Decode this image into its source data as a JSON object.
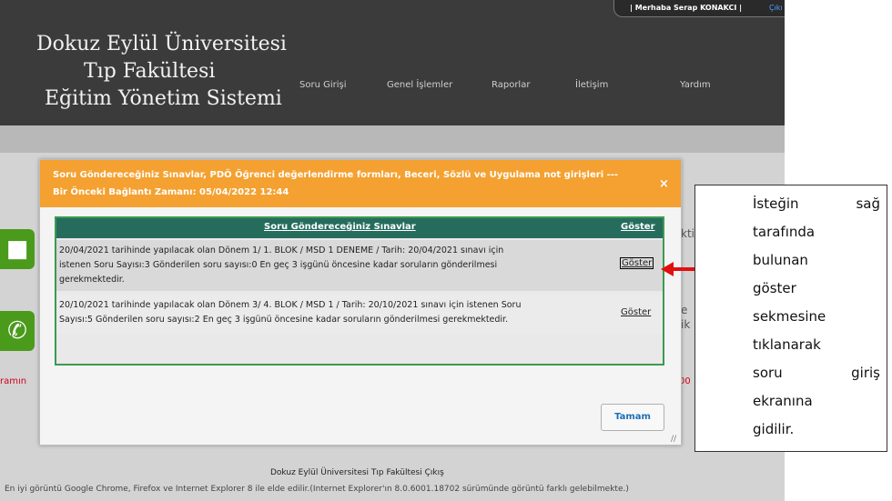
{
  "header": {
    "greeting": "| Merhaba Serap KONAKCI |",
    "logout": "Çıkı",
    "title_lines": [
      "Dokuz Eylül Üniversitesi",
      "Tıp Fakültesi",
      "Eğitim Yönetim Sistemi"
    ],
    "nav": [
      "Soru Girişi",
      "Genel İşlemler",
      "Raporlar",
      "İletişim",
      "Yardım"
    ]
  },
  "background": {
    "red_text": "ramın",
    "red_right": "00",
    "partial_right_1": "kti",
    "partial_right_2a": "e",
    "partial_right_2b": "ik"
  },
  "modal": {
    "header_line1": "Soru Göndereceğiniz Sınavlar, PDÖ Öğrenci değerlendirme formları, Beceri, Sözlü ve Uygulama not girişleri ---",
    "header_line2": "Bir Önceki Bağlantı Zamanı: 05/04/2022 12:44",
    "close": "×",
    "table_title": "Soru Göndereceğiniz Sınavlar",
    "table_show": "Göster",
    "rows": [
      {
        "lines": [
          "20/04/2021 tarihinde yapılacak olan Dönem 1/ 1. BLOK / MSD 1 DENEME / Tarih: 20/04/2021 sınavı için",
          "istenen Soru Sayısı:3 Gönderilen soru sayısı:0 En geç 3 işgünü öncesine kadar soruların gönderilmesi",
          "gerekmektedir."
        ],
        "action": "Göster"
      },
      {
        "lines": [
          "20/10/2021 tarihinde yapılacak olan Dönem 3/ 4. BLOK / MSD 1 / Tarih: 20/10/2021 sınavı için istenen Soru",
          "Sayısı:5 Gönderilen soru sayısı:2 En geç 3 işgünü öncesine kadar soruların gönderilmesi gerekmektedir."
        ],
        "action": "Göster"
      }
    ],
    "ok_button": "Tamam"
  },
  "callout": {
    "lines": [
      [
        "İsteğin",
        "sağ"
      ],
      [
        "tarafında"
      ],
      [
        "bulunan"
      ],
      [
        "göster"
      ],
      [
        "sekmesine"
      ],
      [
        "tıklanarak"
      ],
      [
        "soru",
        "giriş"
      ],
      [
        "ekranına"
      ],
      [
        "gidilir."
      ]
    ]
  },
  "footer": {
    "title": "Dokuz Eylül Üniversitesi Tıp Fakültesi Çıkış",
    "note": "En iyi görüntü Google Chrome, Firefox  ve  Internet Explorer 8 ile elde edilir.(Internet Explorer'ın 8.0.6001.18702 sürümünde görüntü farklı gelebilmekte.)"
  },
  "colors": {
    "header_bg": "#3b3b3b",
    "modal_header": "#f4a131",
    "table_header": "#256c5d",
    "arrow": "#e01010",
    "ok_text": "#1d6fb5"
  }
}
